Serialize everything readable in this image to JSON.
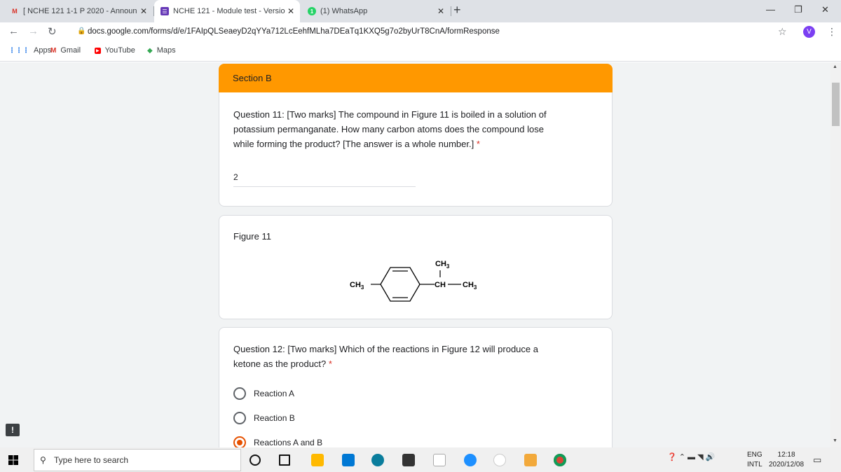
{
  "tabs": [
    {
      "icon": "gmail-icon",
      "title": "[ NCHE 121 1-1 P 2020 - Announ"
    },
    {
      "icon": "google-forms-icon",
      "title": "NCHE 121 - Module test - Versio"
    },
    {
      "icon": "whatsapp-icon",
      "title": "(1) WhatsApp"
    }
  ],
  "address": {
    "url": "docs.google.com/forms/d/e/1FAIpQLSeaeyD2qYYa712LcEehfMLha7DEaTq1KXQ5g7o2byUrT8CnA/formResponse"
  },
  "profile": {
    "initial": "V"
  },
  "bookmarks": [
    {
      "icon": "apps-icon",
      "label": "Apps"
    },
    {
      "icon": "gmail-icon",
      "label": "Gmail"
    },
    {
      "icon": "youtube-icon",
      "label": "YouTube"
    },
    {
      "icon": "maps-icon",
      "label": "Maps"
    }
  ],
  "form": {
    "section_title": "Section B",
    "q11": {
      "line1": "Question 11: [Two marks] The compound in Figure 11 is boiled in a solution of",
      "line2": "potassium permanganate. How many carbon atoms does the compound lose",
      "line3": "while forming the product? [The answer is a whole number.]",
      "required": "*",
      "answer": "2"
    },
    "figure": {
      "title": "Figure 11",
      "labels": {
        "left_methyl": "CH",
        "left_sub": "3",
        "top_methyl": "CH",
        "top_sub": "3",
        "ch": "CH",
        "right_methyl": "CH",
        "right_sub": "3"
      }
    },
    "q12": {
      "line1": "Question 12: [Two marks] Which of the reactions in Figure 12 will produce a",
      "line2": "ketone as the product?",
      "required": "*",
      "options": [
        {
          "label": "Reaction A",
          "selected": false
        },
        {
          "label": "Reaction B",
          "selected": false
        },
        {
          "label": "Reactions A and B",
          "selected": true
        }
      ]
    }
  },
  "taskbar": {
    "search_placeholder": "Type here to search",
    "lang_line1": "ENG",
    "lang_line2": "INTL",
    "time": "12:18",
    "date": "2020/12/08"
  }
}
